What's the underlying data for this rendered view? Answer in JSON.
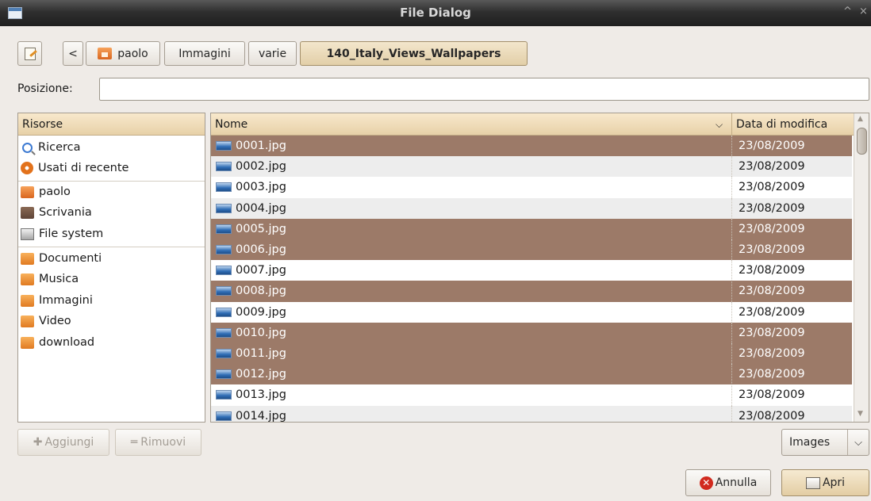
{
  "window": {
    "title": "File Dialog",
    "controls": [
      "^",
      "×"
    ]
  },
  "toolbar": {
    "edit_icon": "edit-location-icon",
    "back_label": "<",
    "breadcrumbs": [
      "paolo",
      "Immagini",
      "varie",
      "140_Italy_Views_Wallpapers"
    ]
  },
  "location": {
    "label": "Posizione:",
    "value": ""
  },
  "places": {
    "header": "Risorse",
    "items": [
      {
        "label": "Ricerca",
        "icon": "search-icon"
      },
      {
        "label": "Usati di recente",
        "icon": "recent-icon"
      },
      {
        "label": "paolo",
        "icon": "home-folder-icon"
      },
      {
        "label": "Scrivania",
        "icon": "desktop-icon"
      },
      {
        "label": "File system",
        "icon": "drive-icon"
      },
      {
        "label": "Documenti",
        "icon": "folder-icon"
      },
      {
        "label": "Musica",
        "icon": "folder-icon"
      },
      {
        "label": "Immagini",
        "icon": "folder-icon"
      },
      {
        "label": "Video",
        "icon": "folder-icon"
      },
      {
        "label": "download",
        "icon": "folder-icon"
      }
    ],
    "add_label": "Aggiungi",
    "remove_label": "Rimuovi"
  },
  "files": {
    "columns": {
      "name": "Nome",
      "modified": "Data di modifica"
    },
    "rows": [
      {
        "name": "0001.jpg",
        "date": "23/08/2009",
        "selected": true
      },
      {
        "name": "0002.jpg",
        "date": "23/08/2009",
        "selected": false
      },
      {
        "name": "0003.jpg",
        "date": "23/08/2009",
        "selected": false
      },
      {
        "name": "0004.jpg",
        "date": "23/08/2009",
        "selected": false
      },
      {
        "name": "0005.jpg",
        "date": "23/08/2009",
        "selected": true
      },
      {
        "name": "0006.jpg",
        "date": "23/08/2009",
        "selected": true
      },
      {
        "name": "0007.jpg",
        "date": "23/08/2009",
        "selected": false
      },
      {
        "name": "0008.jpg",
        "date": "23/08/2009",
        "selected": true
      },
      {
        "name": "0009.jpg",
        "date": "23/08/2009",
        "selected": false
      },
      {
        "name": "0010.jpg",
        "date": "23/08/2009",
        "selected": true
      },
      {
        "name": "0011.jpg",
        "date": "23/08/2009",
        "selected": true
      },
      {
        "name": "0012.jpg",
        "date": "23/08/2009",
        "selected": true
      },
      {
        "name": "0013.jpg",
        "date": "23/08/2009",
        "selected": false
      },
      {
        "name": "0014.jpg",
        "date": "23/08/2009",
        "selected": false
      }
    ]
  },
  "filter": {
    "value": "Images"
  },
  "actions": {
    "cancel_label": "Annulla",
    "open_label": "Apri"
  },
  "colors": {
    "selection": "#9c7a68",
    "header": "#e7d1a8",
    "window_bg": "#efebe7"
  }
}
